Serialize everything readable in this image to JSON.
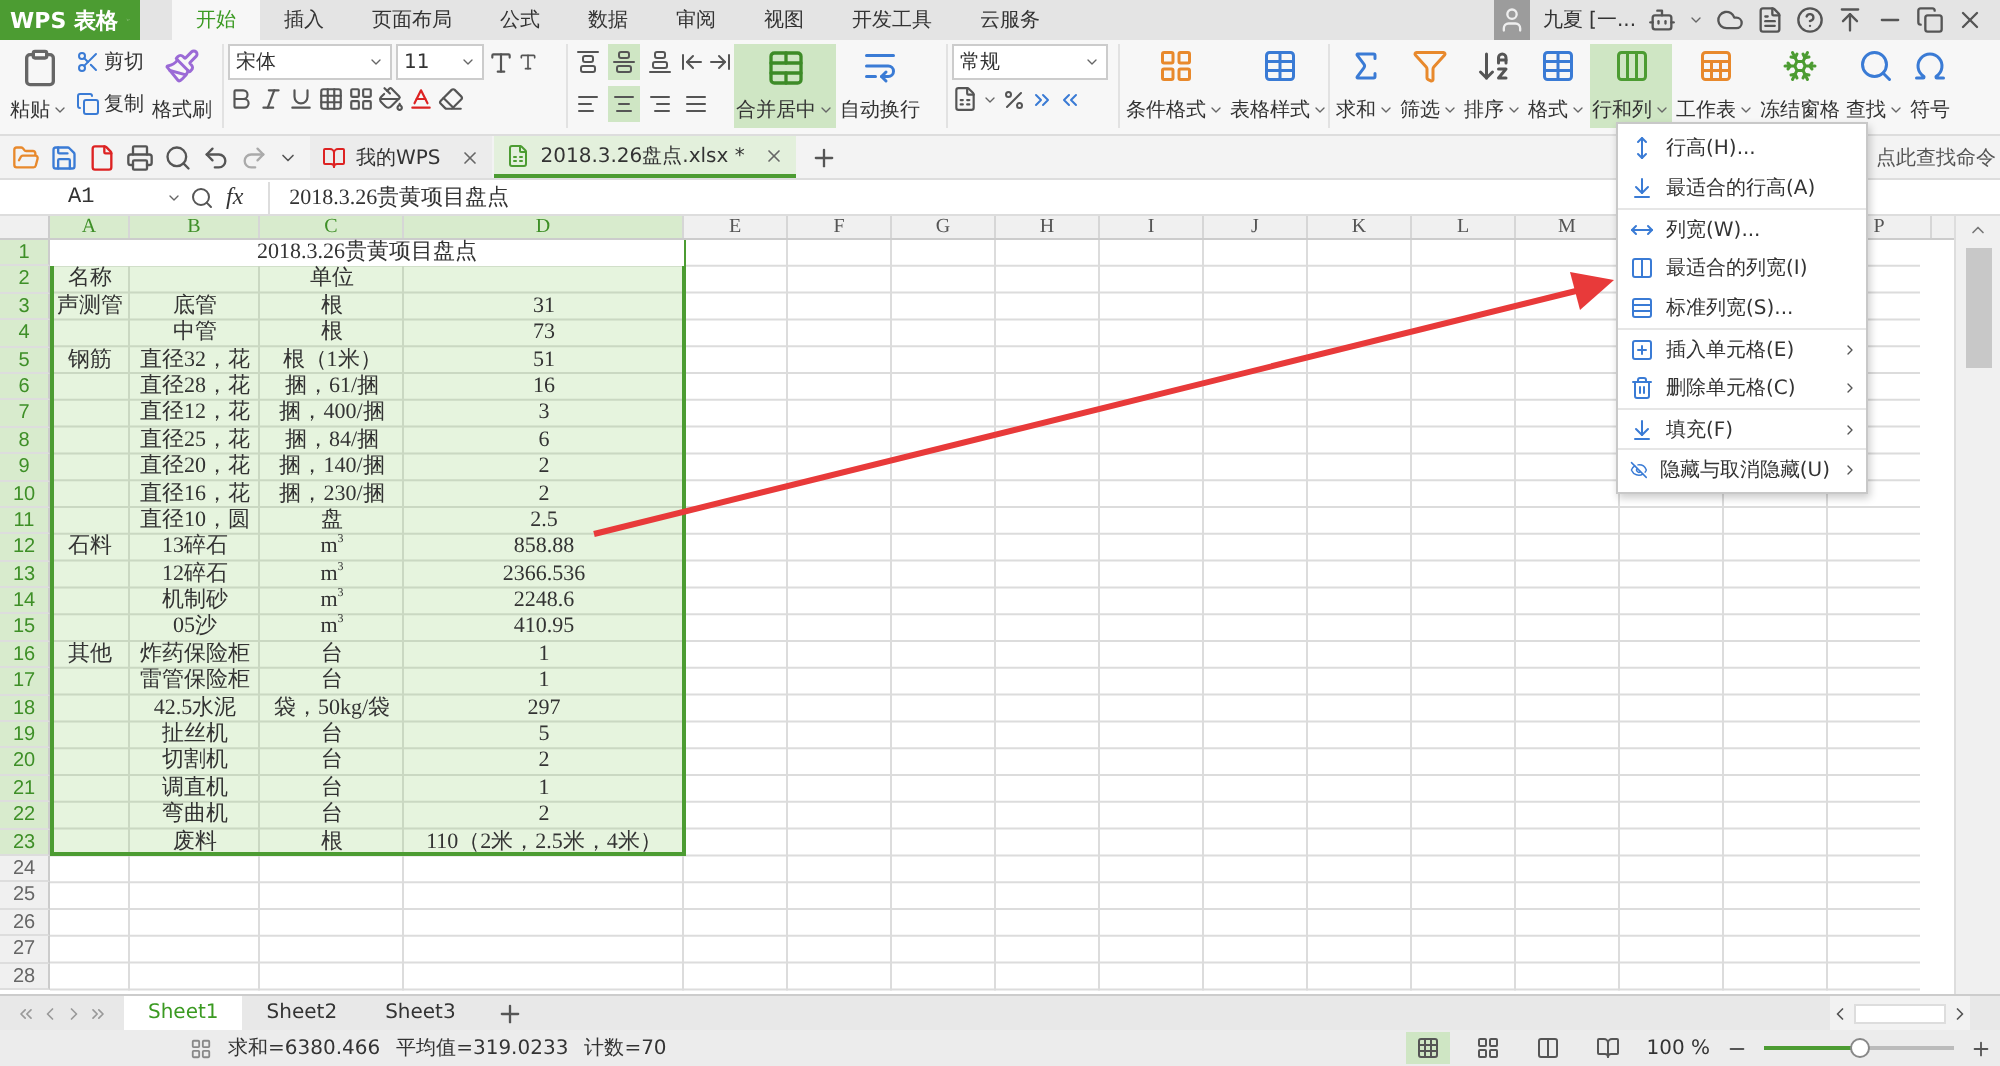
{
  "app_button": {
    "label": "WPS 表格"
  },
  "ribbon_tabs": [
    {
      "label": "开始",
      "selected": true
    },
    {
      "label": "插入",
      "selected": false
    },
    {
      "label": "页面布局",
      "selected": false
    },
    {
      "label": "公式",
      "selected": false
    },
    {
      "label": "数据",
      "selected": false
    },
    {
      "label": "审阅",
      "selected": false
    },
    {
      "label": "视图",
      "selected": false
    },
    {
      "label": "开发工具",
      "selected": false
    },
    {
      "label": "云服务",
      "selected": false
    }
  ],
  "user": {
    "name": "九夏 [一..."
  },
  "clipboard": {
    "paste": "粘贴",
    "cut": "剪切",
    "copy": "复制",
    "format_painter": "格式刷"
  },
  "font": {
    "name": "宋体",
    "size": "11"
  },
  "alignment": {
    "valign": [
      {
        "selected": false
      },
      {
        "selected": true
      },
      {
        "selected": false
      }
    ],
    "halign": [
      {
        "selected": false
      },
      {
        "selected": true
      },
      {
        "selected": false
      },
      {
        "selected": false
      }
    ],
    "merge": {
      "label": "合并居中",
      "selected": true
    },
    "wrap": {
      "label": "自动换行",
      "selected": false
    }
  },
  "number": {
    "format": "常规"
  },
  "styles": [
    {
      "label": "条件格式"
    },
    {
      "label": "表格样式"
    }
  ],
  "tools": [
    {
      "kind": "sum",
      "label": "求和",
      "dropdown": true,
      "selected": false
    },
    {
      "kind": "filter",
      "label": "筛选",
      "dropdown": true,
      "selected": false
    },
    {
      "kind": "sort",
      "label": "排序",
      "dropdown": true,
      "selected": false
    },
    {
      "kind": "format",
      "label": "格式",
      "dropdown": true,
      "selected": false
    },
    {
      "kind": "rowcol",
      "label": "行和列",
      "dropdown": true,
      "selected": true
    },
    {
      "kind": "sheet",
      "label": "工作表",
      "dropdown": true,
      "selected": false
    },
    {
      "kind": "freeze",
      "label": "冻结窗格",
      "dropdown": false,
      "selected": false
    },
    {
      "kind": "find",
      "label": "查找",
      "dropdown": true,
      "selected": false
    },
    {
      "kind": "symbol",
      "label": "符号",
      "dropdown": false,
      "selected": false
    }
  ],
  "doc_tabs": [
    {
      "label": "我的WPS",
      "selected": false
    },
    {
      "label": "2018.3.26盘点.xlsx *",
      "selected": true
    }
  ],
  "command_search": {
    "placeholder": "点此查找命令"
  },
  "formula_bar": {
    "cell": "A1",
    "fx": "fx",
    "value": "2018.3.26贵黄项目盘点"
  },
  "columns": [
    {
      "label": "A",
      "selected": true
    },
    {
      "label": "B",
      "selected": true
    },
    {
      "label": "C",
      "selected": true
    },
    {
      "label": "D",
      "selected": true
    },
    {
      "label": "E",
      "selected": false
    },
    {
      "label": "F",
      "selected": false
    },
    {
      "label": "G",
      "selected": false
    },
    {
      "label": "H",
      "selected": false
    },
    {
      "label": "I",
      "selected": false
    },
    {
      "label": "J",
      "selected": false
    },
    {
      "label": "K",
      "selected": false
    },
    {
      "label": "L",
      "selected": false
    },
    {
      "label": "M",
      "selected": false
    },
    {
      "label": "P",
      "selected": false
    }
  ],
  "rows": [
    {
      "num": "1",
      "selected": true,
      "title": "2018.3.26贵黄项目盘点"
    },
    {
      "num": "2",
      "selected": true,
      "a": "名称",
      "c": "单位"
    },
    {
      "num": "3",
      "selected": true,
      "a": "声测管",
      "b": "底管",
      "c": "根",
      "d": "31"
    },
    {
      "num": "4",
      "selected": true,
      "b": "中管",
      "c": "根",
      "d": "73"
    },
    {
      "num": "5",
      "selected": true,
      "a": "钢筋",
      "b": "直径32，花",
      "c": "根（1米）",
      "d": "51"
    },
    {
      "num": "6",
      "selected": true,
      "b": "直径28，花",
      "c": "捆，61/捆",
      "d": "16"
    },
    {
      "num": "7",
      "selected": true,
      "b": "直径12，花",
      "c": "捆，400/捆",
      "d": "3"
    },
    {
      "num": "8",
      "selected": true,
      "b": "直径25，花",
      "c": "捆，84/捆",
      "d": "6"
    },
    {
      "num": "9",
      "selected": true,
      "b": "直径20，花",
      "c": "捆，140/捆",
      "d": "2"
    },
    {
      "num": "10",
      "selected": true,
      "b": "直径16，花",
      "c": "捆，230/捆",
      "d": "2"
    },
    {
      "num": "11",
      "selected": true,
      "b": "直径10，圆",
      "c": "盘",
      "d": "2.5"
    },
    {
      "num": "12",
      "selected": true,
      "a": "石料",
      "b": "13碎石",
      "c": "m$^{3}$",
      "d": "858.88"
    },
    {
      "num": "13",
      "selected": true,
      "b": "12碎石",
      "c": "m$^{3}$",
      "d": "2366.536"
    },
    {
      "num": "14",
      "selected": true,
      "b": "机制砂",
      "c": "m$^{3}$",
      "d": "2248.6"
    },
    {
      "num": "15",
      "selected": true,
      "b": "05沙",
      "c": "m$^{3}$",
      "d": "410.95"
    },
    {
      "num": "16",
      "selected": true,
      "a": "其他",
      "b": "炸药保险柜",
      "c": "台",
      "d": "1"
    },
    {
      "num": "17",
      "selected": true,
      "b": "雷管保险柜",
      "c": "台",
      "d": "1"
    },
    {
      "num": "18",
      "selected": true,
      "b": "42.5水泥",
      "c": "袋，50kg/袋",
      "d": "297"
    },
    {
      "num": "19",
      "selected": true,
      "b": "扯丝机",
      "c": "台",
      "d": "5"
    },
    {
      "num": "20",
      "selected": true,
      "b": "切割机",
      "c": "台",
      "d": "2"
    },
    {
      "num": "21",
      "selected": true,
      "b": "调直机",
      "c": "台",
      "d": "1"
    },
    {
      "num": "22",
      "selected": true,
      "b": "弯曲机",
      "c": "台",
      "d": "2"
    },
    {
      "num": "23",
      "selected": true,
      "b": "废料",
      "c": "根",
      "d": "110（2米，2.5米，4米）"
    },
    {
      "num": "24",
      "selected": false
    },
    {
      "num": "25",
      "selected": false
    },
    {
      "num": "26",
      "selected": false
    },
    {
      "num": "27",
      "selected": false
    },
    {
      "num": "28",
      "selected": false
    }
  ],
  "menu": [
    {
      "kind": "rowheight",
      "label": "行高(H)...",
      "separator_before": false,
      "submenu": false
    },
    {
      "kind": "autoheight",
      "label": "最适合的行高(A)",
      "separator_before": false,
      "submenu": false
    },
    {
      "kind": "colwidth",
      "label": "列宽(W)...",
      "separator_before": true,
      "submenu": false
    },
    {
      "kind": "autowidth",
      "label": "最适合的列宽(I)",
      "separator_before": false,
      "submenu": false
    },
    {
      "kind": "stdwidth",
      "label": "标准列宽(S)...",
      "separator_before": false,
      "submenu": false
    },
    {
      "kind": "insert",
      "label": "插入单元格(E)",
      "separator_before": true,
      "submenu": true
    },
    {
      "kind": "delete",
      "label": "删除单元格(C)",
      "separator_before": false,
      "submenu": true
    },
    {
      "kind": "fill",
      "label": "填充(F)",
      "separator_before": true,
      "submenu": true
    },
    {
      "kind": "hide",
      "label": "隐藏与取消隐藏(U)",
      "separator_before": true,
      "submenu": true
    }
  ],
  "sheet_tabs": [
    {
      "label": "Sheet1",
      "selected": true
    },
    {
      "label": "Sheet2",
      "selected": false
    },
    {
      "label": "Sheet3",
      "selected": false
    }
  ],
  "status_bar": {
    "sum": "求和=6380.466",
    "average": "平均值=319.0233",
    "count": "计数=70",
    "views": [
      {
        "selected": true
      },
      {
        "selected": false
      },
      {
        "selected": false
      },
      {
        "selected": false
      }
    ],
    "zoom": "100 %",
    "zoom_slider": {
      "level": 0.5
    }
  },
  "annotation": {
    "kind": "arrow"
  }
}
